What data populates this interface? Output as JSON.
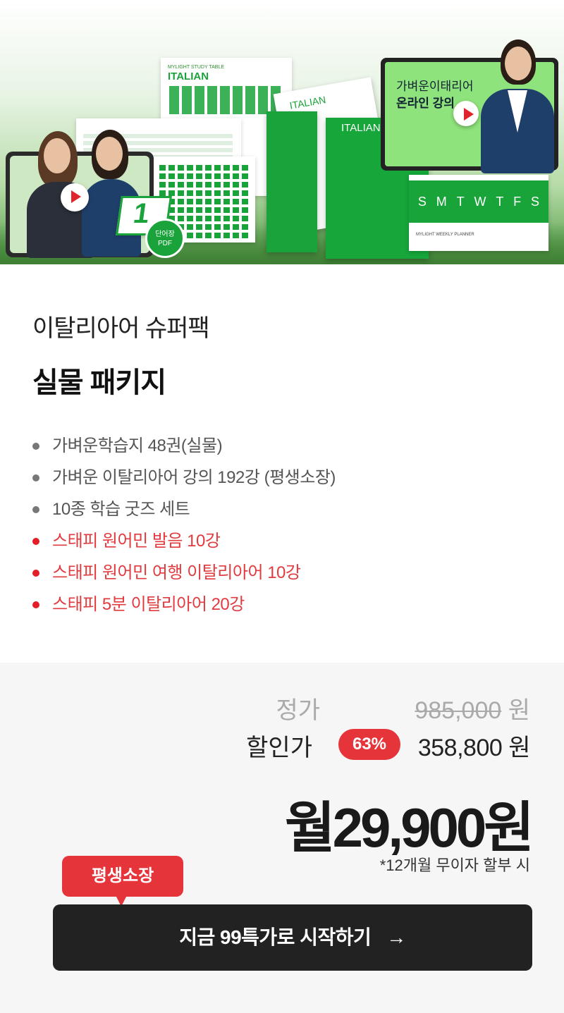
{
  "hero": {
    "study_table_header": "MYLIGHT STUDY TABLE",
    "study_table_title": "ITALIAN",
    "book_label_1": "ITALIAN",
    "book_label_2": "ITALIAN",
    "monitor_line1": "가벼운이태리어",
    "monitor_line2": "온라인 강의",
    "calendar_days": [
      "S",
      "M",
      "T",
      "W",
      "T",
      "F",
      "S"
    ],
    "planner_label": "MYLIGHT WEEKLY PLANNER",
    "vocab_number": "1",
    "vocab_pdf": "단어장\nPDF",
    "colors": {
      "green": "#1aa33a",
      "light_green": "#9be08a",
      "dark_green": "#0b8a2b"
    }
  },
  "product": {
    "subtitle": "이탈리아어 슈퍼팩",
    "title": "실물 패키지",
    "features": [
      {
        "text": "가벼운학습지 48권(실물)",
        "highlight": false
      },
      {
        "text": "가벼운 이탈리아어 강의 192강 (평생소장)",
        "highlight": false
      },
      {
        "text": "10종 학습 굿즈 세트",
        "highlight": false
      },
      {
        "text": "스태피 원어민 발음 10강",
        "highlight": true
      },
      {
        "text": "스태피 원어민 여행 이탈리아어 10강",
        "highlight": true
      },
      {
        "text": "스태피 5분 이탈리아어 20강",
        "highlight": true
      }
    ]
  },
  "pricing": {
    "regular_label": "정가",
    "regular_price": "985,000",
    "won": "원",
    "sale_label": "할인가",
    "discount": "63%",
    "sale_price": "358,800 원",
    "monthly": "월29,900원",
    "installment_note": "*12개월 무이자 할부 시",
    "accent_color": "#e6343b"
  },
  "cta": {
    "badge": "평생소장",
    "label": "지금 99특가로 시작하기",
    "arrow": "→"
  }
}
